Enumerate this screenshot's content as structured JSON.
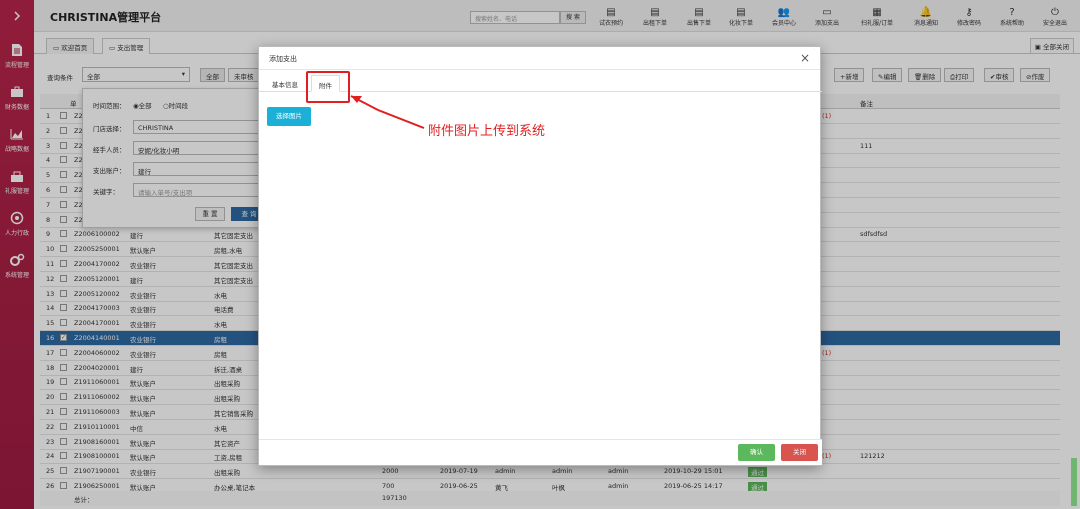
{
  "sidebar": {
    "items": [
      {
        "label": "流程管理",
        "icon": "document-icon"
      },
      {
        "label": "财务数据",
        "icon": "briefcase-icon"
      },
      {
        "label": "战略数据",
        "icon": "chart-icon"
      },
      {
        "label": "礼服管理",
        "icon": "bag-icon"
      },
      {
        "label": "人力行政",
        "icon": "network-icon"
      },
      {
        "label": "系统管理",
        "icon": "gears-icon"
      }
    ]
  },
  "header": {
    "title": "CHRISTINA管理平台",
    "search_placeholder": "搜索姓名、电话",
    "search_button": "搜 索",
    "toolbar": [
      {
        "label": "试衣预约",
        "icon": "file-icon"
      },
      {
        "label": "出租下单",
        "icon": "file-icon"
      },
      {
        "label": "出售下单",
        "icon": "file-icon"
      },
      {
        "label": "化妆下单",
        "icon": "file-icon"
      },
      {
        "label": "会员中心",
        "icon": "users-icon"
      },
      {
        "label": "添加支出",
        "icon": "card-icon"
      },
      {
        "label": "扫礼服/订单",
        "icon": "qr-icon"
      },
      {
        "label": "消息通知",
        "icon": "bell-icon"
      },
      {
        "label": "修改密码",
        "icon": "key-icon"
      },
      {
        "label": "系统帮助",
        "icon": "help-icon"
      },
      {
        "label": "安全退出",
        "icon": "power-icon"
      }
    ]
  },
  "tabs": {
    "home": "欢迎首页",
    "expense": "支出管理",
    "close_all": "全部关闭"
  },
  "query": {
    "label": "查询条件",
    "select_value": "全部",
    "btn_all": "全部",
    "btn_pending": "未审核",
    "btn_new": "新增",
    "btn_edit": "编辑",
    "btn_delete": "删除",
    "btn_print": "打印",
    "btn_audit": "审核",
    "btn_void": "作废"
  },
  "filter": {
    "time_range_label": "时间范围：",
    "time_all": "全部",
    "time_period": "时间段",
    "store_label": "门店选择：",
    "store_value": "CHRISTINA",
    "person_label": "经手人员：",
    "person_value": "安妮/化妆小明",
    "account_label": "支出账户：",
    "account_value": "建行",
    "keyword_label": "关键字：",
    "keyword_placeholder": "请输入单号/支出项",
    "reset": "重 置",
    "query": "查 询"
  },
  "table": {
    "header_remark": "备注",
    "header_single": "单",
    "rows": [
      {
        "n": "1",
        "code": "Z2",
        "acct": "",
        "item": "",
        "tail": "(1)",
        "remark": ""
      },
      {
        "n": "2",
        "code": "Z2",
        "acct": "",
        "item": "",
        "tail": "",
        "remark": ""
      },
      {
        "n": "3",
        "code": "Z2",
        "acct": "",
        "item": "",
        "tail": "",
        "remark": "111"
      },
      {
        "n": "4",
        "code": "Z2",
        "acct": "",
        "item": "",
        "tail": "",
        "remark": ""
      },
      {
        "n": "5",
        "code": "Z2",
        "acct": "",
        "item": "",
        "tail": "",
        "remark": ""
      },
      {
        "n": "6",
        "code": "Z2",
        "acct": "",
        "item": "",
        "tail": "",
        "remark": ""
      },
      {
        "n": "7",
        "code": "Z2",
        "acct": "",
        "item": "",
        "tail": "",
        "remark": ""
      },
      {
        "n": "8",
        "code": "Z2",
        "acct": "",
        "item": "",
        "tail": "",
        "remark": ""
      },
      {
        "n": "9",
        "code": "Z2006100002",
        "acct": "建行",
        "item": "其它固定支出",
        "tail": "",
        "remark": "sdfsdfsd"
      },
      {
        "n": "10",
        "code": "Z2005250001",
        "acct": "默认账户",
        "item": "房租,水电",
        "tail": "",
        "remark": ""
      },
      {
        "n": "11",
        "code": "Z2004170002",
        "acct": "农业银行",
        "item": "其它固定支出",
        "tail": "",
        "remark": ""
      },
      {
        "n": "12",
        "code": "Z2005120001",
        "acct": "建行",
        "item": "其它固定支出",
        "tail": "",
        "remark": ""
      },
      {
        "n": "13",
        "code": "Z2005120002",
        "acct": "农业银行",
        "item": "水电",
        "tail": "",
        "remark": ""
      },
      {
        "n": "14",
        "code": "Z2004170003",
        "acct": "农业银行",
        "item": "电话费",
        "tail": "",
        "remark": ""
      },
      {
        "n": "15",
        "code": "Z2004170001",
        "acct": "农业银行",
        "item": "水电",
        "tail": "",
        "remark": ""
      },
      {
        "n": "16",
        "code": "Z2004140001",
        "acct": "农业银行",
        "item": "房租",
        "tail": "",
        "remark": ""
      },
      {
        "n": "17",
        "code": "Z2004060002",
        "acct": "农业银行",
        "item": "房租",
        "tail": "(1)",
        "remark": ""
      },
      {
        "n": "18",
        "code": "Z2004020001",
        "acct": "建行",
        "item": "拆迁,酒桌",
        "tail": "",
        "remark": ""
      },
      {
        "n": "19",
        "code": "Z1911060001",
        "acct": "默认账户",
        "item": "出租采购",
        "tail": "",
        "remark": ""
      },
      {
        "n": "20",
        "code": "Z1911060002",
        "acct": "默认账户",
        "item": "出租采购",
        "tail": "",
        "remark": ""
      },
      {
        "n": "21",
        "code": "Z1911060003",
        "acct": "默认账户",
        "item": "其它销售采购",
        "tail": "",
        "remark": ""
      },
      {
        "n": "22",
        "code": "Z1910110001",
        "acct": "中信",
        "item": "水电",
        "tail": "",
        "remark": ""
      },
      {
        "n": "23",
        "code": "Z1908160001",
        "acct": "默认账户",
        "item": "其它资产",
        "tail": "",
        "remark": ""
      },
      {
        "n": "24",
        "code": "Z1908100001",
        "acct": "默认账户",
        "item": "工资,房租",
        "tail": "(1)",
        "remark": "121212"
      },
      {
        "n": "25",
        "code": "Z1907190001",
        "acct": "农业银行",
        "item": "出租采购",
        "amount": "2000",
        "date": "2019-07-19",
        "p1": "admin",
        "p2": "admin",
        "p3": "admin",
        "time": "2019-10-29 15:01",
        "badge": "通过",
        "tail": "",
        "remark": ""
      },
      {
        "n": "26",
        "code": "Z1906250001",
        "acct": "默认账户",
        "item": "办公桌,笔记本",
        "amount": "700",
        "date": "2019-06-25",
        "p1": "黄飞",
        "p2": "叶枫",
        "p3": "admin",
        "time": "2019-06-25 14:17",
        "badge": "通过",
        "tail": "",
        "remark": ""
      }
    ],
    "total_label": "总计：",
    "total_value": "197130"
  },
  "dialog": {
    "title": "添加支出",
    "tab_basic": "基本信息",
    "tab_attach": "附件",
    "select_image": "选择图片",
    "ok": "确认",
    "close": "关闭"
  },
  "annotation": {
    "text": "附件图片上传到系统"
  },
  "colors": {
    "sidebar": "#a82047",
    "selected_row": "#2d6aa3",
    "select_image_btn": "#1bb0d8",
    "ok_btn": "#5cb85c",
    "close_btn": "#d9534f",
    "annotation": "#e02020"
  }
}
